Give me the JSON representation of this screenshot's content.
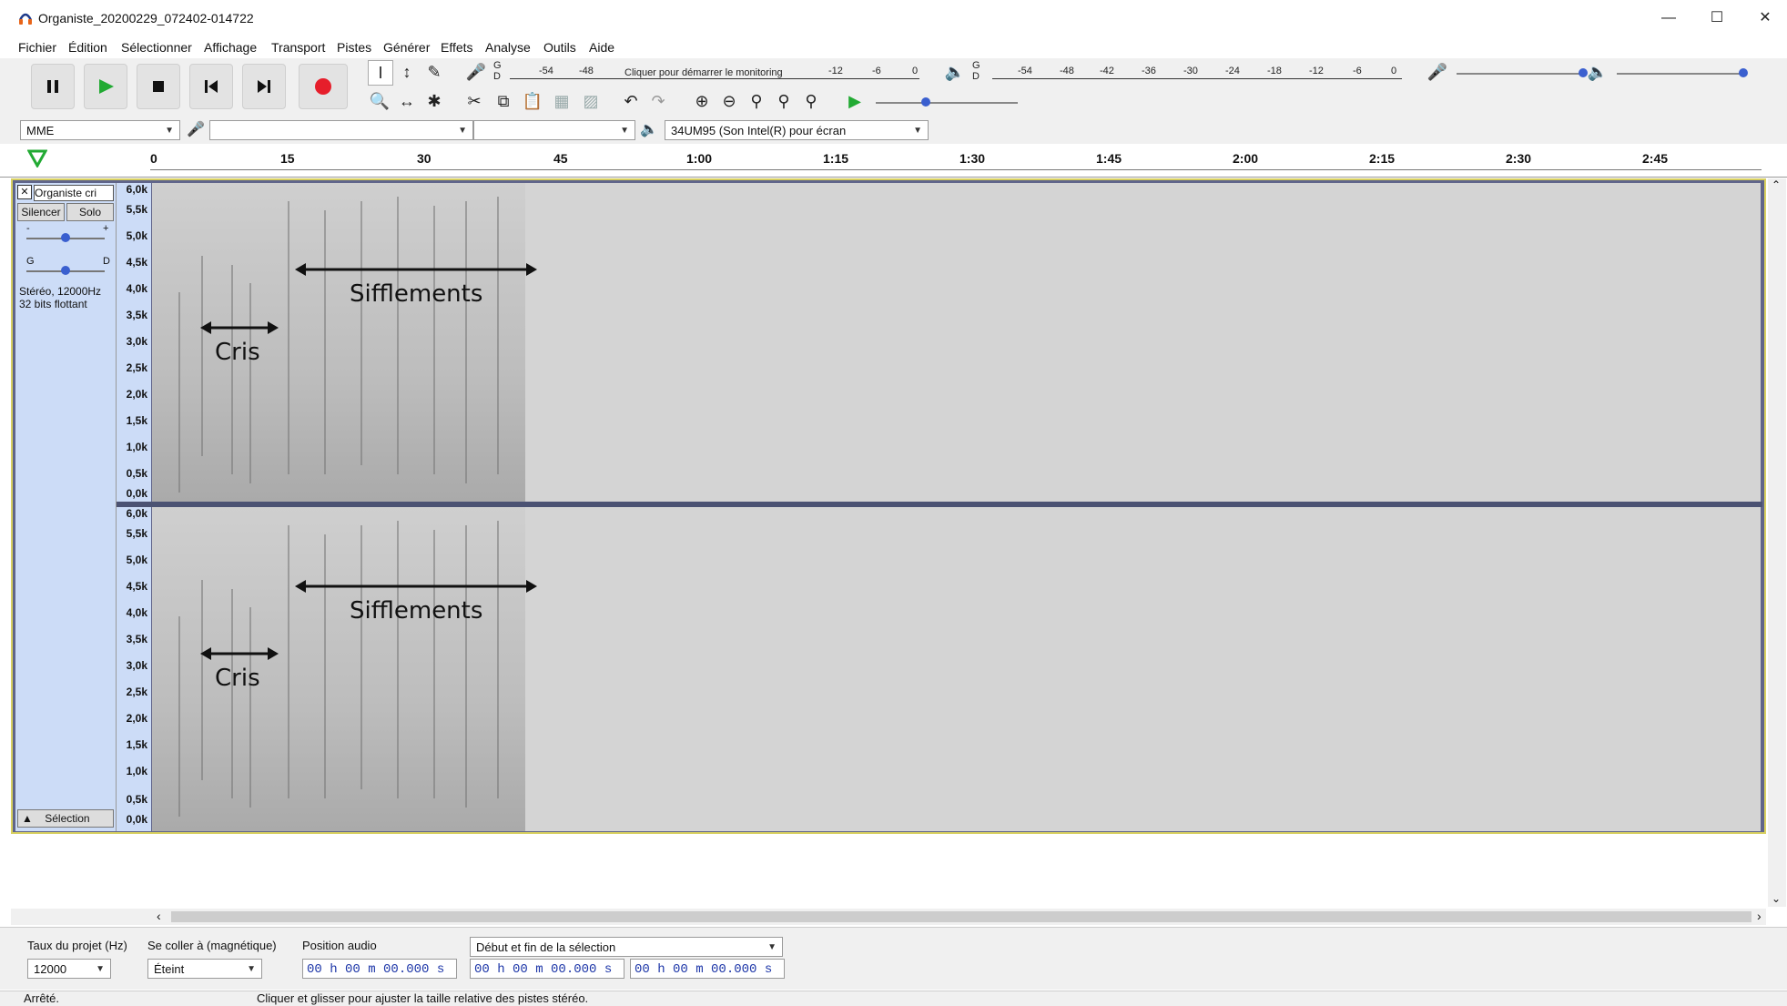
{
  "window": {
    "title": "Organiste_20200229_072402-014722"
  },
  "menu": [
    "Fichier",
    "Édition",
    "Sélectionner",
    "Affichage",
    "Transport",
    "Pistes",
    "Générer",
    "Effets",
    "Analyse",
    "Outils",
    "Aide"
  ],
  "record_meter": {
    "channels": "G\nD",
    "ticks": [
      "-54",
      "-48"
    ],
    "label": "Cliquer pour démarrer le monitoring",
    "ticks2": [
      "-12",
      "-6",
      "0"
    ]
  },
  "play_meter": {
    "channels": "G\nD",
    "ticks": [
      "-54",
      "-48",
      "-42",
      "-36",
      "-30",
      "-24",
      "-18",
      "-12",
      "-6",
      "0"
    ]
  },
  "device": {
    "host": "MME",
    "output": "34UM95 (Son Intel(R) pour écran"
  },
  "ruler": [
    "0",
    "15",
    "30",
    "45",
    "1:00",
    "1:15",
    "1:30",
    "1:45",
    "2:00",
    "2:15",
    "2:30",
    "2:45"
  ],
  "track": {
    "name": "Organiste cri",
    "mute": "Silencer",
    "solo": "Solo",
    "gain_minus": "-",
    "gain_plus": "+",
    "pan_left": "G",
    "pan_right": "D",
    "info_line1": "Stéréo, 12000Hz",
    "info_line2": "32 bits flottant",
    "select": "Sélection",
    "freq_labels": [
      "6,0k",
      "5,5k",
      "5,0k",
      "4,5k",
      "4,0k",
      "3,5k",
      "3,0k",
      "2,5k",
      "2,0k",
      "1,5k",
      "1,0k",
      "0,5k",
      "0,0k"
    ]
  },
  "annotations": {
    "cris": "Cris",
    "sifflements": "Sifflements"
  },
  "selection_toolbar": {
    "rate_label": "Taux du projet (Hz)",
    "rate_value": "12000",
    "snap_label": "Se coller à (magnétique)",
    "snap_value": "Éteint",
    "pos_label": "Position audio",
    "pos_value": "00 h 00 m 00.000 s",
    "sel_mode": "Début et fin de la sélection",
    "sel_start": "00 h 00 m 00.000 s",
    "sel_end": "00 h 00 m 00.000 s"
  },
  "status": {
    "state": "Arrêté.",
    "hint": "Cliquer et glisser pour ajuster la taille relative des pistes stéréo."
  }
}
